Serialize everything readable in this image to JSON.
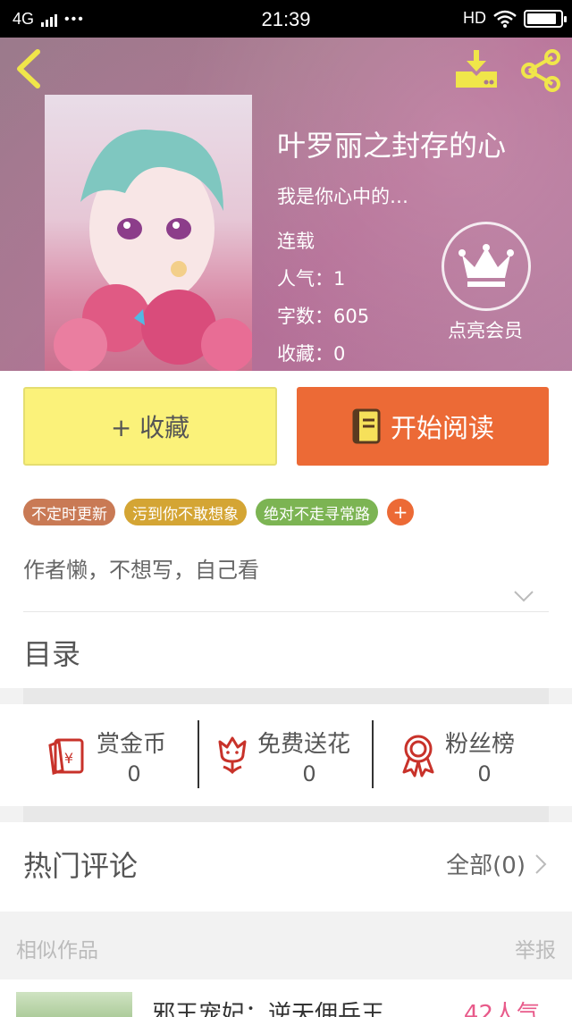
{
  "status_bar": {
    "network": "4G",
    "time": "21:39",
    "hd": "HD",
    "battery_level": 0.9
  },
  "book": {
    "title": "叶罗丽之封存的心",
    "subtitle": "我是你心中的…",
    "status": "连载",
    "popularity": "人气：1",
    "word_count": "字数：605",
    "favorites": "收藏：0"
  },
  "vip": {
    "label": "点亮会员"
  },
  "actions": {
    "collect_label": "+ 收藏",
    "read_label": "开始阅读"
  },
  "tags": [
    {
      "label": "不定时更新",
      "color": "#c97a55"
    },
    {
      "label": "污到你不敢想象",
      "color": "#d4a534"
    },
    {
      "label": "绝对不走寻常路",
      "color": "#7cb453"
    }
  ],
  "tag_more": "+",
  "description": "作者懒，不想写，自己看",
  "toc_label": "目录",
  "stats": [
    {
      "label": "赏金币",
      "count": "0",
      "icon": "red-envelope-icon"
    },
    {
      "label": "免费送花",
      "count": "0",
      "icon": "flower-icon"
    },
    {
      "label": "粉丝榜",
      "count": "0",
      "icon": "ribbon-medal-icon"
    }
  ],
  "comments": {
    "title": "热门评论",
    "all_label": "全部(0)"
  },
  "similar": {
    "title": "相似作品",
    "report": "举报",
    "items": [
      {
        "title": "邪王宠妃：逆天佣兵王",
        "popularity": "42人气"
      }
    ]
  },
  "colors": {
    "accent_orange": "#ec6a36",
    "collect_yellow": "#fbf27a",
    "icon_red": "#c8322a"
  }
}
